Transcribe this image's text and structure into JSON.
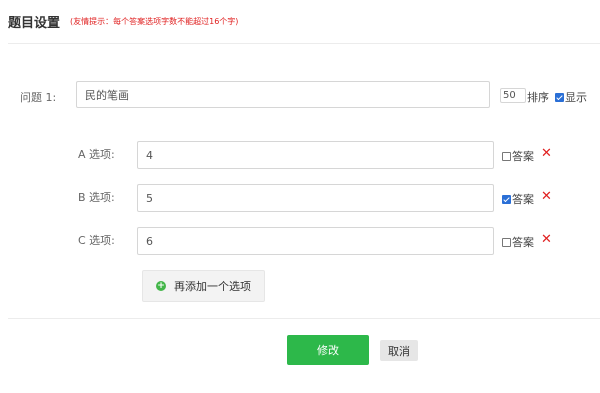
{
  "header": {
    "title": "题目设置",
    "hint": "(友情提示：每个答案选项字数不能超过16个字)"
  },
  "question": {
    "label": "问题  1:",
    "value": "民的笔画",
    "sort_value": "50",
    "sort_label": "排序",
    "display_label": "显示",
    "display_checked": true
  },
  "options": [
    {
      "label": "A  选项:",
      "value": "4",
      "answer_label": "答案",
      "answer_checked": false,
      "delete_icon": "✕"
    },
    {
      "label": "B  选项:",
      "value": "5",
      "answer_label": "答案",
      "answer_checked": true,
      "delete_icon": "✕"
    },
    {
      "label": "C  选项:",
      "value": "6",
      "answer_label": "答案",
      "answer_checked": false,
      "delete_icon": "✕"
    }
  ],
  "add_option": {
    "label": "再添加一个选项",
    "icon": "plus-circle-icon"
  },
  "actions": {
    "submit_label": "修改",
    "cancel_label": "取消"
  },
  "colors": {
    "accent_green": "#2db84a",
    "hint_red": "#e02020",
    "checkbox_blue": "#2a6fd6"
  }
}
